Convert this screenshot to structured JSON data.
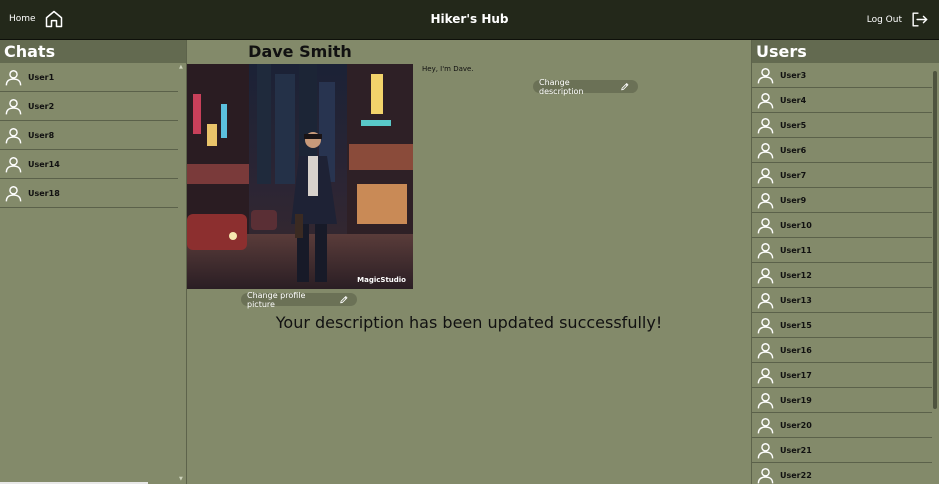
{
  "header": {
    "home_label": "Home",
    "title": "Hiker's Hub",
    "logout_label": "Log Out"
  },
  "chats": {
    "title": "Chats",
    "items": [
      "User1",
      "User2",
      "User8",
      "User14",
      "User18"
    ]
  },
  "users": {
    "title": "Users",
    "items": [
      "User3",
      "User4",
      "User5",
      "User6",
      "User7",
      "User9",
      "User10",
      "User11",
      "User12",
      "User13",
      "User15",
      "User16",
      "User17",
      "User19",
      "User20",
      "User21",
      "User22"
    ]
  },
  "profile": {
    "name": "Dave Smith",
    "description": "Hey, I'm Dave.",
    "change_description_label": "Change description",
    "change_picture_label": "Change profile picture",
    "picture_watermark": "MagicStudio"
  },
  "status": {
    "message": "Your description has been updated successfully!"
  },
  "icons": {
    "home": "home-icon",
    "logout": "logout-icon",
    "user": "user-icon",
    "edit": "pencil-icon"
  },
  "colors": {
    "background": "#838a6a",
    "header": "#23281a",
    "panel_title": "#636a50",
    "pill": "#6b7156"
  }
}
